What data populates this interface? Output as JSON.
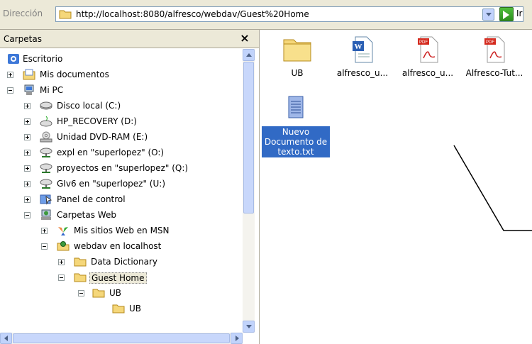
{
  "address": {
    "label": "Dirección",
    "url": "http://localhost:8080/alfresco/webdav/Guest%20Home",
    "go_text": "Ir"
  },
  "panel": {
    "title": "Carpetas",
    "close": "×"
  },
  "tree": [
    {
      "label": "Escritorio",
      "icon": "desktop-icon"
    },
    {
      "label": "Mis documentos",
      "icon": "my-documents-icon"
    },
    {
      "label": "Mi PC",
      "icon": "my-computer-icon"
    },
    {
      "label": "Disco local (C:)",
      "icon": "hard-disk-icon"
    },
    {
      "label": "HP_RECOVERY (D:)",
      "icon": "hard-disk-icon"
    },
    {
      "label": "Unidad DVD-RAM (E:)",
      "icon": "dvd-drive-icon"
    },
    {
      "label": "expl en \"superlopez\" (O:)",
      "icon": "network-drive-icon"
    },
    {
      "label": "proyectos en \"superlopez\" (Q:)",
      "icon": "network-drive-icon"
    },
    {
      "label": "GIv6 en \"superlopez\" (U:)",
      "icon": "network-drive-icon"
    },
    {
      "label": "Panel de control",
      "icon": "control-panel-icon"
    },
    {
      "label": "Carpetas Web",
      "icon": "web-folders-icon"
    },
    {
      "label": "Mis sitios Web en MSN",
      "icon": "msn-icon"
    },
    {
      "label": "webdav en localhost",
      "icon": "web-folder-icon"
    },
    {
      "label": "Data Dictionary",
      "icon": "folder-icon"
    },
    {
      "label": "Guest Home",
      "icon": "folder-icon"
    },
    {
      "label": "UB",
      "icon": "folder-icon"
    },
    {
      "label": "UB",
      "icon": "folder-icon"
    }
  ],
  "files": [
    {
      "name": "UB",
      "icon": "folder-icon"
    },
    {
      "name": "alfresco_u...",
      "icon": "word-document-icon"
    },
    {
      "name": "alfresco_u...",
      "icon": "pdf-icon"
    },
    {
      "name": "Alfresco-Tut...",
      "icon": "pdf-icon"
    },
    {
      "name": "Nuevo Documento de texto.txt",
      "icon": "text-file-icon",
      "selected": true
    }
  ],
  "colors": {
    "selection": "#316ac5",
    "chrome": "#ece9d8",
    "folder": "#f5d77a"
  }
}
